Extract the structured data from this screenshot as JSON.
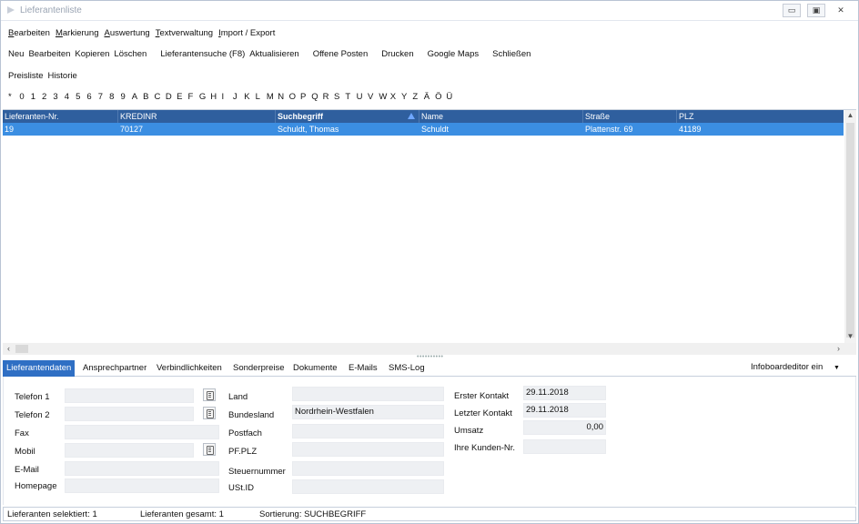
{
  "window": {
    "title": "Lieferantenliste",
    "buttons": {
      "minimize": "▭",
      "maximize": "▣",
      "close": "✕"
    }
  },
  "menu": {
    "items": [
      {
        "u": "B",
        "rest": "earbeiten"
      },
      {
        "u": "M",
        "rest": "arkierung"
      },
      {
        "u": "A",
        "rest": "uswertung"
      },
      {
        "u": "T",
        "rest": "extverwaltung"
      },
      {
        "u": "I",
        "rest": "mport / Export"
      }
    ]
  },
  "toolbar": {
    "items": [
      "Neu",
      "Bearbeiten",
      "Kopieren",
      "Löschen",
      "Lieferantensuche (F8)",
      "Aktualisieren",
      "Offene Posten",
      "Drucken",
      "Google Maps",
      "Schließen"
    ],
    "row2": [
      "Preisliste",
      "Historie"
    ]
  },
  "alphabet": [
    "*",
    "0",
    "1",
    "2",
    "3",
    "4",
    "5",
    "6",
    "7",
    "8",
    "9",
    "A",
    "B",
    "C",
    "D",
    "E",
    "F",
    "G",
    "H",
    "I",
    "J",
    "K",
    "L",
    "M",
    "N",
    "O",
    "P",
    "Q",
    "R",
    "S",
    "T",
    "U",
    "V",
    "W",
    "X",
    "Y",
    "Z",
    "Ä",
    "Ö",
    "Ü"
  ],
  "grid": {
    "columns": [
      "Lieferanten-Nr.",
      "KREDINR",
      "Suchbegriff",
      "Name",
      "Straße",
      "PLZ"
    ],
    "rows": [
      [
        "19",
        "70127",
        "Schuldt, Thomas",
        "Schuldt",
        "Plattenstr. 69",
        "41189"
      ]
    ],
    "sort_column": "Suchbegriff",
    "colors": {
      "header": "#2f5f9e",
      "selected_row": "#3b8ee2"
    }
  },
  "tabs": {
    "items": [
      "Lieferantendaten",
      "Ansprechpartner",
      "Verbindlichkeiten",
      "Sonderpreise",
      "Dokumente",
      "E-Mails",
      "SMS-Log"
    ],
    "active": "Lieferantendaten",
    "infoboard": "Infoboardeditor ein",
    "infoboard_caret": "▼"
  },
  "form": {
    "col1": {
      "labels": [
        "Telefon 1",
        "Telefon 2",
        "Fax",
        "Mobil",
        "E-Mail",
        "Homepage"
      ],
      "values": [
        "",
        "",
        "",
        "",
        "",
        ""
      ]
    },
    "col2": {
      "labels": [
        "Land",
        "Bundesland",
        "Postfach",
        "PF.PLZ",
        "Steuernummer",
        "USt.ID"
      ],
      "values": [
        "",
        "Nordrhein-Westfalen",
        "",
        "",
        "",
        ""
      ]
    },
    "col3": {
      "labels": [
        "Erster Kontakt",
        "Letzter Kontakt",
        "Umsatz",
        "Ihre Kunden-Nr."
      ],
      "values": [
        "29.11.2018",
        "29.11.2018",
        "0,00",
        ""
      ]
    }
  },
  "status": {
    "selected": "Lieferanten selektiert: 1",
    "total": "Lieferanten gesamt: 1",
    "sorting": "Sortierung: SUCHBEGRIFF"
  }
}
